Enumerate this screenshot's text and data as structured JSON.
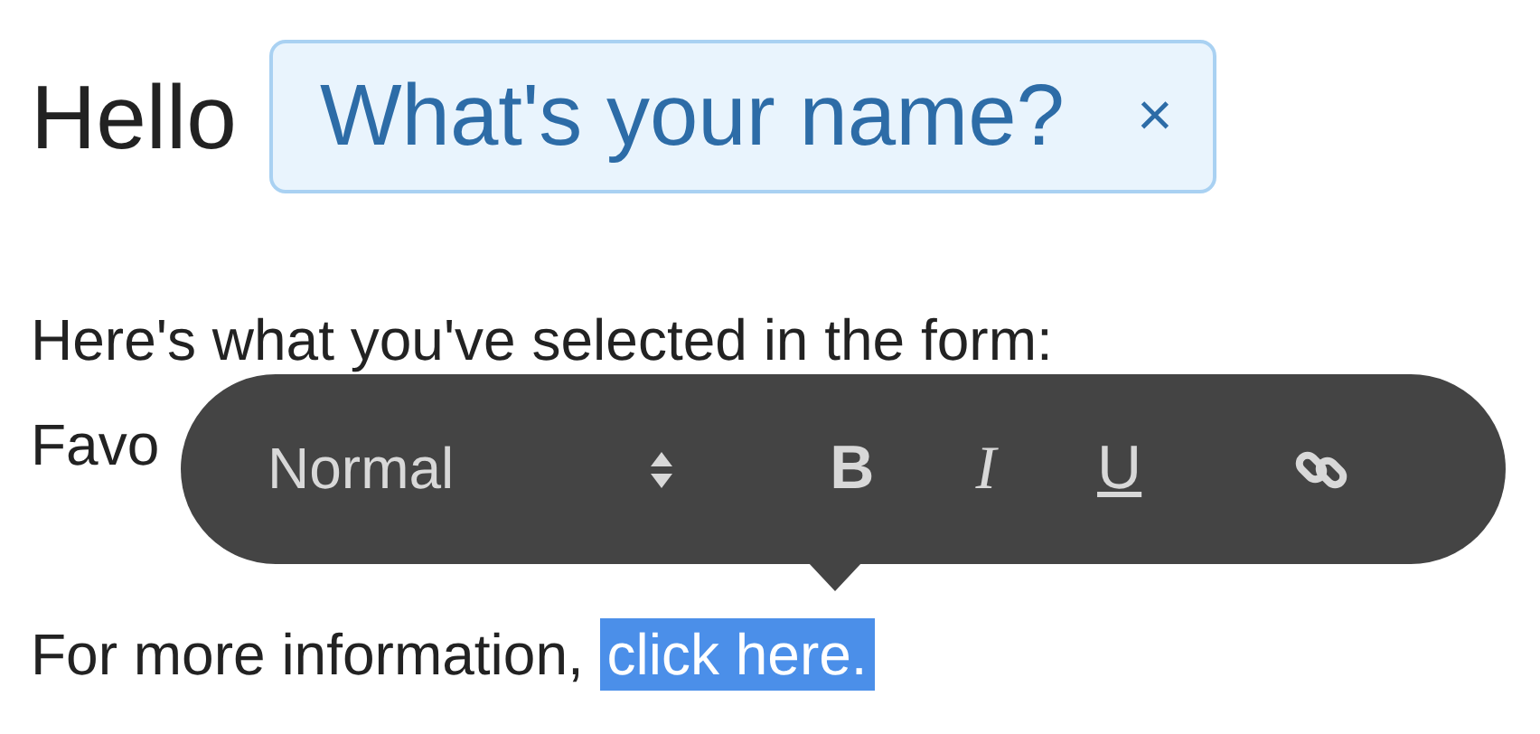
{
  "greeting": "Hello",
  "name_tag": {
    "text": "What's your name?",
    "close": "×"
  },
  "lines": [
    "Here's what you've selected in the form:",
    "Favo"
  ],
  "toolbar": {
    "format": "Normal",
    "buttons": [
      {
        "label": "B",
        "kind": "bold"
      },
      {
        "label": "I",
        "kind": "italic"
      },
      {
        "label": "U",
        "kind": "underline"
      },
      {
        "kind": "link"
      }
    ]
  },
  "info": {
    "text": "For more information, ",
    "link": "click here.",
    "selected": true
  }
}
